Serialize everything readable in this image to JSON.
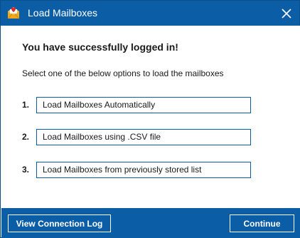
{
  "window": {
    "title": "Load Mailboxes",
    "app_icon": "mailbox-app-icon",
    "close_icon": "close-icon"
  },
  "main": {
    "heading": "You have successfully logged in!",
    "instruction": "Select one of the below options to load the mailboxes",
    "options": [
      {
        "number": "1.",
        "label": "Load Mailboxes Automatically"
      },
      {
        "number": "2.",
        "label": "Load Mailboxes using .CSV file"
      },
      {
        "number": "3.",
        "label": "Load Mailboxes from previously stored list"
      }
    ]
  },
  "footer": {
    "log_button": "View Connection Log",
    "continue_button": "Continue"
  },
  "colors": {
    "accent": "#0b5ea5",
    "text": "#1a1a1a",
    "background": "#ffffff"
  }
}
